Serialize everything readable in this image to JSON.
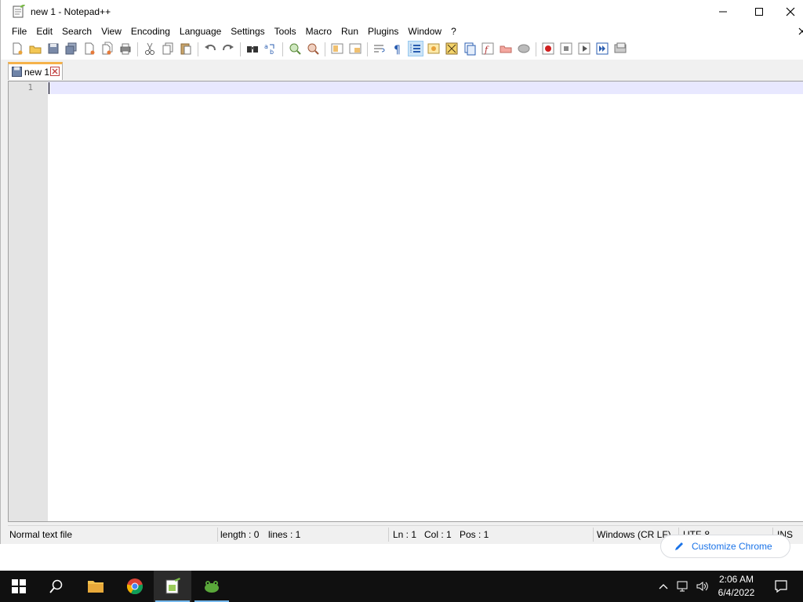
{
  "window": {
    "title": "new 1 - Notepad++"
  },
  "menu": {
    "items": [
      "File",
      "Edit",
      "Search",
      "View",
      "Encoding",
      "Language",
      "Settings",
      "Tools",
      "Macro",
      "Run",
      "Plugins",
      "Window",
      "?"
    ]
  },
  "tab": {
    "label": "new 1"
  },
  "editor": {
    "line_number": "1"
  },
  "status": {
    "file_type": "Normal text file",
    "length": "length : 0",
    "lines": "lines : 1",
    "ln": "Ln : 1",
    "col": "Col : 1",
    "pos": "Pos : 1",
    "eol": "Windows (CR LF)",
    "encoding": "UTF-8",
    "mode": "INS"
  },
  "chrome": {
    "customize_label": "Customize Chrome"
  },
  "taskbar": {
    "time": "2:06 AM",
    "date": "6/4/2022"
  },
  "colors": {
    "tab_accent": "#f5b24a",
    "current_line": "#e8e8ff",
    "chrome_link": "#1a73e8",
    "taskbar": "#101010"
  }
}
